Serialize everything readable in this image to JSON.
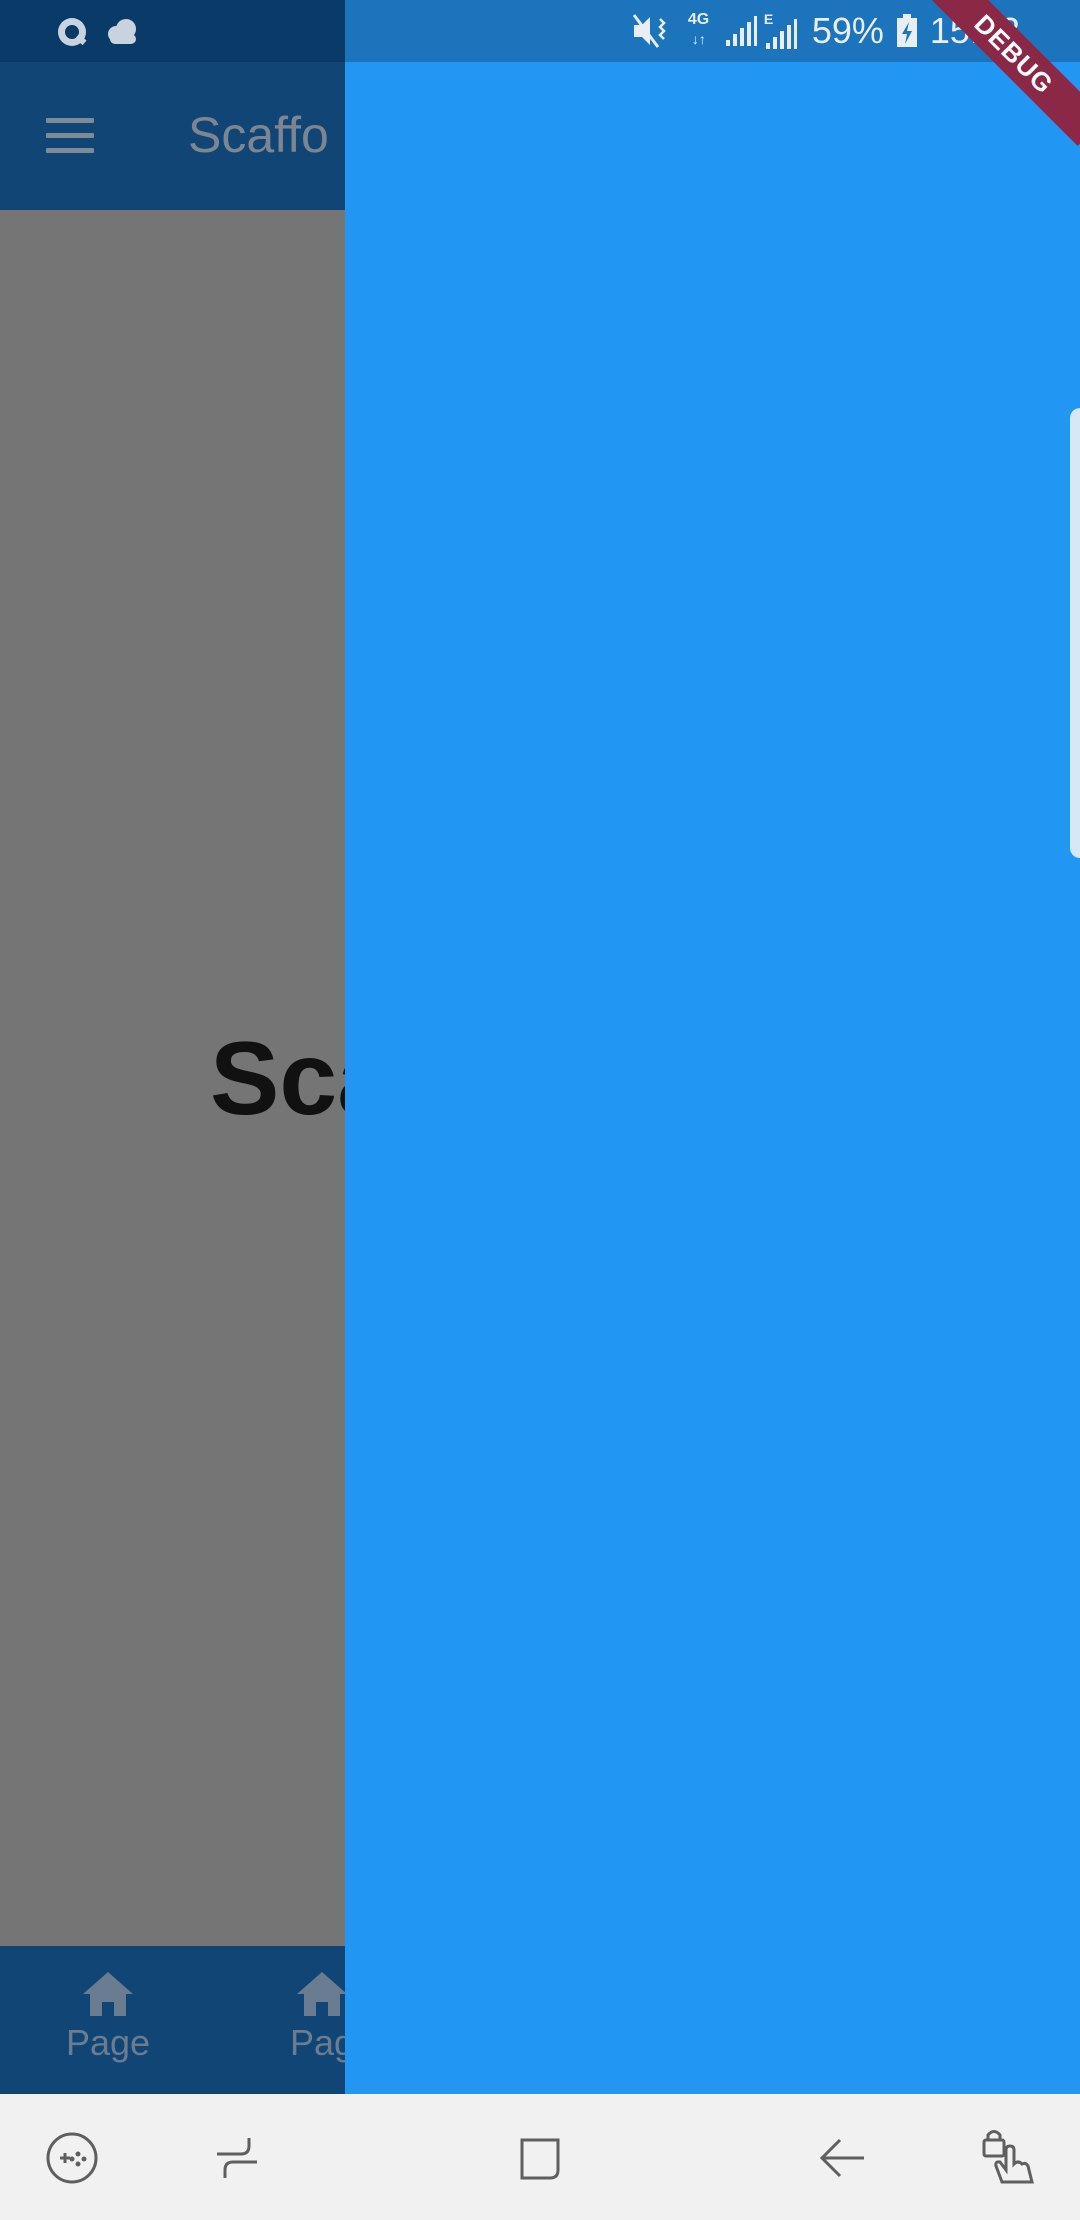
{
  "status_bar": {
    "battery": "59%",
    "time": "15:53",
    "network_4g": "4G",
    "network_e": "E",
    "left_icons": [
      "q-app-icon",
      "cloud-icon"
    ],
    "right_icons": [
      "mute-vibrate-icon",
      "signal-icon",
      "signal-icon",
      "battery-icon"
    ]
  },
  "app_bar": {
    "title": "Scaffo",
    "menu_icon": "menu-icon"
  },
  "body": {
    "center_text": "Sca"
  },
  "bottom_nav": {
    "items": [
      {
        "label": "Page",
        "icon": "home-icon"
      },
      {
        "label": "Pag",
        "icon": "home-icon"
      }
    ]
  },
  "drawer": {
    "color": "#2196f3",
    "debug_banner": "DEBUG"
  },
  "system_nav": {
    "buttons": [
      "game-tools-icon",
      "recent-apps-icon",
      "home-square-icon",
      "back-icon",
      "touch-lock-icon"
    ]
  }
}
